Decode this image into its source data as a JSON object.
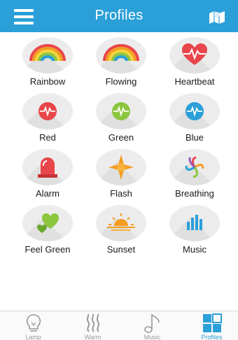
{
  "header": {
    "title": "Profiles",
    "menu_icon": "hamburger-icon",
    "right_icon": "map-icon"
  },
  "profiles": [
    {
      "label": "Rainbow",
      "icon": "rainbow-icon"
    },
    {
      "label": "Flowing",
      "icon": "rainbow-icon"
    },
    {
      "label": "Heartbeat",
      "icon": "heartbeat-icon"
    },
    {
      "label": "Red",
      "icon": "pulse-icon",
      "color": "#e8464b"
    },
    {
      "label": "Green",
      "icon": "pulse-icon",
      "color": "#8cc63f"
    },
    {
      "label": "Blue",
      "icon": "pulse-icon",
      "color": "#2a9fd8"
    },
    {
      "label": "Alarm",
      "icon": "alarm-icon"
    },
    {
      "label": "Flash",
      "icon": "flash-icon"
    },
    {
      "label": "Breathing",
      "icon": "breathing-icon"
    },
    {
      "label": "Feel Green",
      "icon": "hearts-icon"
    },
    {
      "label": "Sunset",
      "icon": "sunset-icon"
    },
    {
      "label": "Music",
      "icon": "bars-icon"
    }
  ],
  "tabs": [
    {
      "label": "Lamp",
      "icon": "bulb-icon",
      "active": false
    },
    {
      "label": "Warm",
      "icon": "heat-icon",
      "active": false
    },
    {
      "label": "Music",
      "icon": "note-icon",
      "active": false
    },
    {
      "label": "Profiles",
      "icon": "grid-icon",
      "active": true
    }
  ],
  "colors": {
    "accent": "#2a9fd8",
    "red": "#e8464b",
    "green": "#8cc63f",
    "orange": "#f39c1f"
  }
}
